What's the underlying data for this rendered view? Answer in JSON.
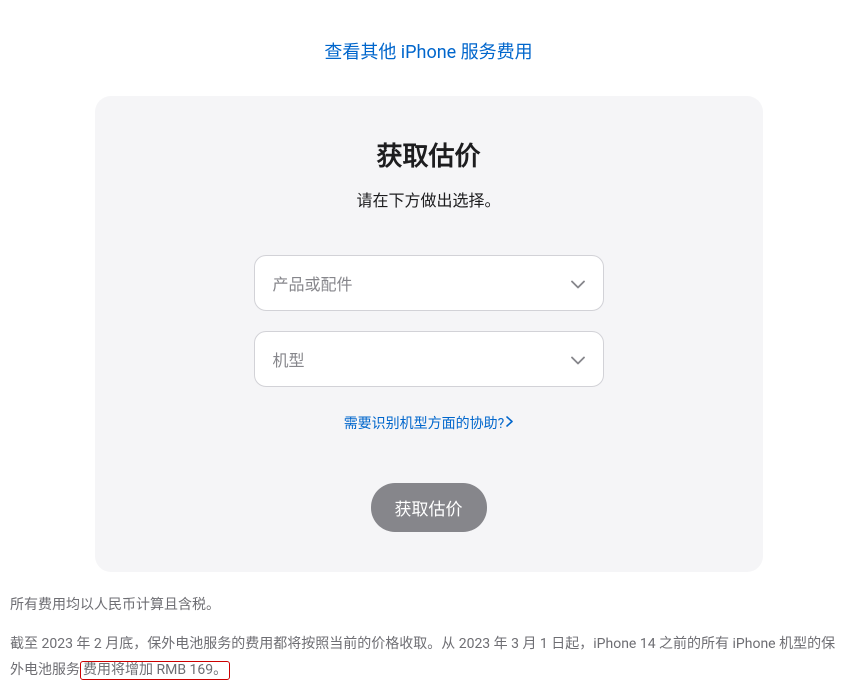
{
  "top": {
    "link_label": "查看其他 iPhone 服务费用"
  },
  "card": {
    "title": "获取估价",
    "subtitle": "请在下方做出选择。",
    "select1_placeholder": "产品或配件",
    "select2_placeholder": "机型",
    "help_link_label": "需要识别机型方面的协助?",
    "submit_label": "获取估价"
  },
  "footer": {
    "line1": "所有费用均以人民币计算且含税。",
    "line2_pre": "截至 2023 年 2 月底，保外电池服务的费用都将按照当前的价格收取。从 2023 年 3 月 1 日起，iPhone 14 之前的所有 iPhone 机型的保外电池服务",
    "line2_highlight": "费用将增加 RMB 169。"
  }
}
